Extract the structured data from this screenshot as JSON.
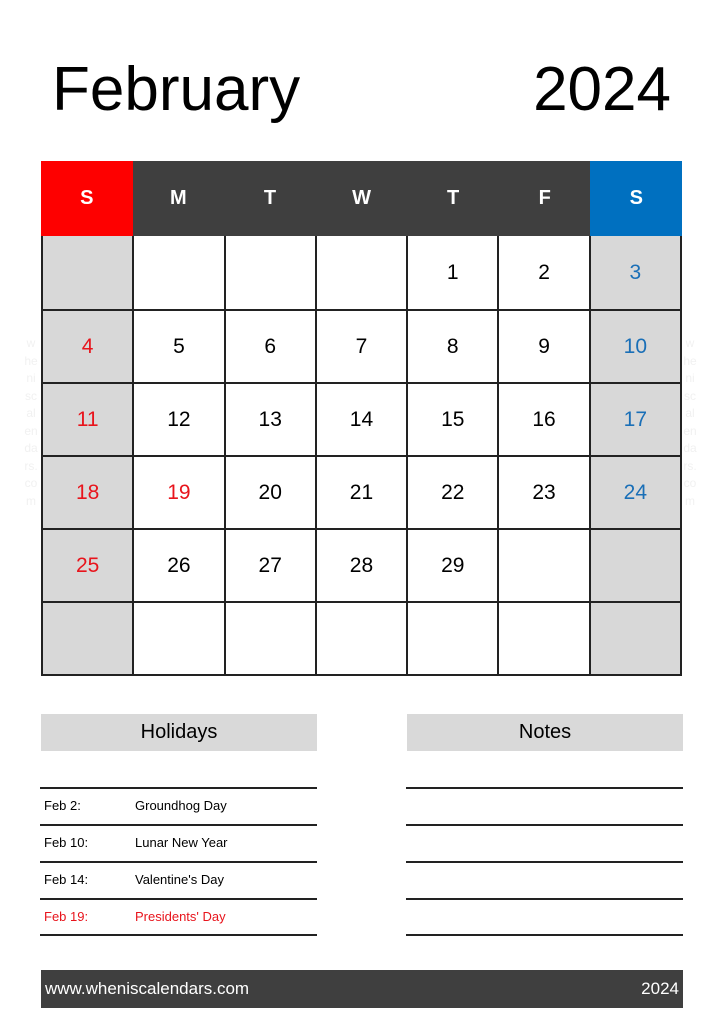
{
  "header": {
    "month": "February",
    "year": "2024"
  },
  "watermark": "wheniscalendars.com",
  "calendar": {
    "weekdays": [
      "S",
      "M",
      "T",
      "W",
      "T",
      "F",
      "S"
    ],
    "weeks": [
      [
        "",
        "",
        "",
        "",
        "1",
        "2",
        "3"
      ],
      [
        "4",
        "5",
        "6",
        "7",
        "8",
        "9",
        "10"
      ],
      [
        "11",
        "12",
        "13",
        "14",
        "15",
        "16",
        "17"
      ],
      [
        "18",
        "19",
        "20",
        "21",
        "22",
        "23",
        "24"
      ],
      [
        "25",
        "26",
        "27",
        "28",
        "29",
        "",
        ""
      ],
      [
        "",
        "",
        "",
        "",
        "",
        "",
        ""
      ]
    ],
    "highlighted_holidays": [
      "19"
    ],
    "colors": {
      "sunday_header": "#fe0000",
      "saturday_header": "#0070c0",
      "weekday_header": "#3f3f3f",
      "weekend_cell": "#d8d8d8",
      "sunday_text": "#e8141c",
      "saturday_text": "#1a6fb7"
    }
  },
  "holidays": {
    "title": "Holidays",
    "items": [
      {
        "date": "Feb 2:",
        "name": "Groundhog Day",
        "highlight": false
      },
      {
        "date": "Feb 10:",
        "name": "Lunar New Year",
        "highlight": false
      },
      {
        "date": "Feb 14:",
        "name": "Valentine's Day",
        "highlight": false
      },
      {
        "date": "Feb 19:",
        "name": "Presidents' Day",
        "highlight": true
      }
    ]
  },
  "notes": {
    "title": "Notes"
  },
  "footer": {
    "website": "www.wheniscalendars.com",
    "year": "2024"
  }
}
